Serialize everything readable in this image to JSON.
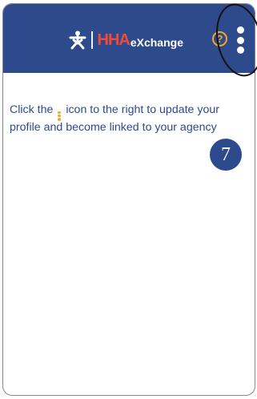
{
  "header": {
    "logo": {
      "brand_hha": "HHA",
      "brand_rest": "eXchange",
      "icon": "person-icon"
    },
    "help_icon": {
      "name": "help-icon",
      "glyph": "?"
    },
    "menu_icon": {
      "name": "kebab-menu-icon"
    }
  },
  "instruction": {
    "text_before": "Click the",
    "inline_icon": "kebab-menu-icon",
    "text_after": "icon to the right to update your profile and become linked to your agency"
  },
  "step": {
    "number": "7"
  },
  "colors": {
    "header_bg": "#2d4a8c",
    "brand_red": "#f04a3a",
    "accent_orange": "#f5a623",
    "text_blue": "#2d4a8c"
  }
}
